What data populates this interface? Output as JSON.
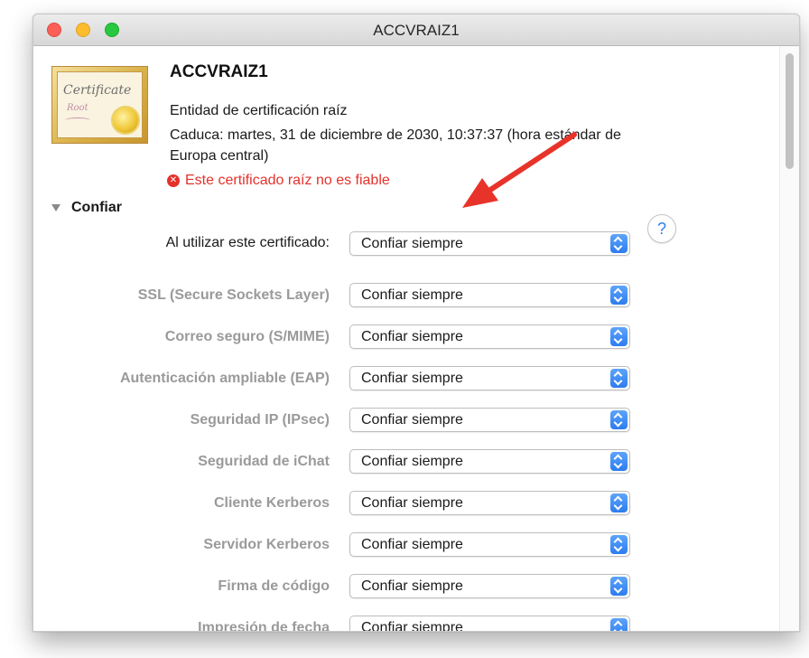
{
  "window": {
    "title": "ACCVRAIZ1"
  },
  "certificate": {
    "icon_word": "Certificate",
    "icon_subword": "Root",
    "name": "ACCVRAIZ1",
    "type": "Entidad de certificación raíz",
    "expires_line1": "Caduca: martes, 31 de diciembre de 2030, 10:37:37 (hora estándar de",
    "expires_line2": "Europa central)",
    "warning": "Este certificado raíz no es fiable",
    "warning_icon": "error-x-icon"
  },
  "trust": {
    "section_label": "Confiar",
    "main_label": "Al utilizar este certificado:",
    "main_value": "Confiar siempre",
    "help_label": "?",
    "rows": [
      {
        "label": "SSL (Secure Sockets Layer)",
        "value": "Confiar siempre"
      },
      {
        "label": "Correo seguro (S/MIME)",
        "value": "Confiar siempre"
      },
      {
        "label": "Autenticación ampliable (EAP)",
        "value": "Confiar siempre"
      },
      {
        "label": "Seguridad IP (IPsec)",
        "value": "Confiar siempre"
      },
      {
        "label": "Seguridad de iChat",
        "value": "Confiar siempre"
      },
      {
        "label": "Cliente Kerberos",
        "value": "Confiar siempre"
      },
      {
        "label": "Servidor Kerberos",
        "value": "Confiar siempre"
      },
      {
        "label": "Firma de código",
        "value": "Confiar siempre"
      },
      {
        "label": "Impresión de fecha",
        "value": "Confiar siempre"
      }
    ]
  },
  "colors": {
    "warning": "#e4312b",
    "accent": "#2c7cf0",
    "annotation_arrow": "#e8332a"
  }
}
